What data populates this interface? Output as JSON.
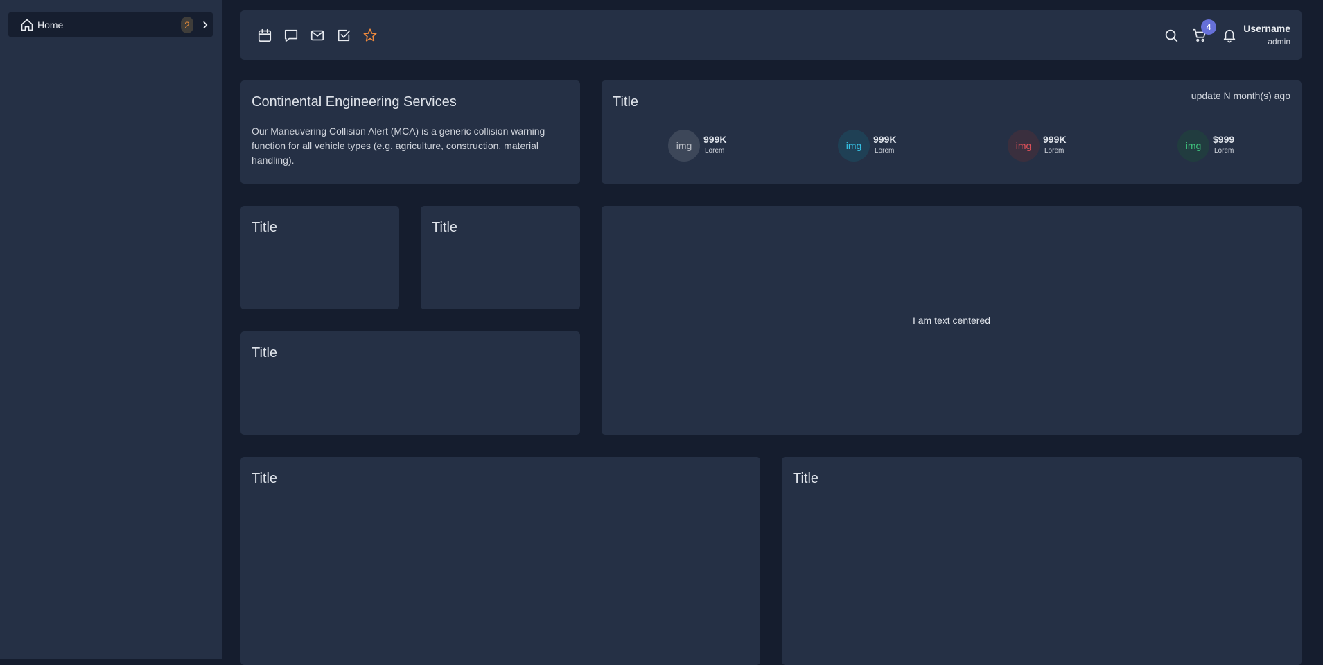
{
  "sidebar": {
    "items": [
      {
        "label": "Home",
        "icon": "home-icon",
        "badge": "2",
        "badge_color": "#e0883a"
      }
    ]
  },
  "topbar": {
    "icons": [
      "calendar-icon",
      "chat-icon",
      "mail-icon",
      "checkbox-icon",
      "star-icon"
    ],
    "star_color": "#f08a3c",
    "cart_count": "4",
    "cart_badge_color": "#6670d8",
    "user": {
      "name": "Username",
      "role": "admin"
    }
  },
  "about": {
    "title": "Continental Engineering Services",
    "description": "Our Maneuvering Collision Alert (MCA) is a generic collision warning function for all vehicle types (e.g. agriculture, construction, material handling)."
  },
  "stats": {
    "title": "Title",
    "update_text": "update N month(s) ago",
    "items": [
      {
        "img": "img",
        "value": "999K",
        "label": "Lorem",
        "color": "#b8bcc4",
        "bg": "#3d4759"
      },
      {
        "img": "img",
        "value": "999K",
        "label": "Lorem",
        "color": "#36c3e6",
        "bg": "#1f4055"
      },
      {
        "img": "img",
        "value": "999K",
        "label": "Lorem",
        "color": "#e0515a",
        "bg": "#3a2f3e"
      },
      {
        "img": "img",
        "value": "$999",
        "label": "Lorem",
        "color": "#3fc27d",
        "bg": "#213c3f"
      }
    ]
  },
  "cards": {
    "small_a_title": "Title",
    "small_b_title": "Title",
    "wide_title": "Title",
    "big_text": "I am text centered",
    "bottom_left_title": "Title",
    "bottom_right_title": "Title"
  }
}
